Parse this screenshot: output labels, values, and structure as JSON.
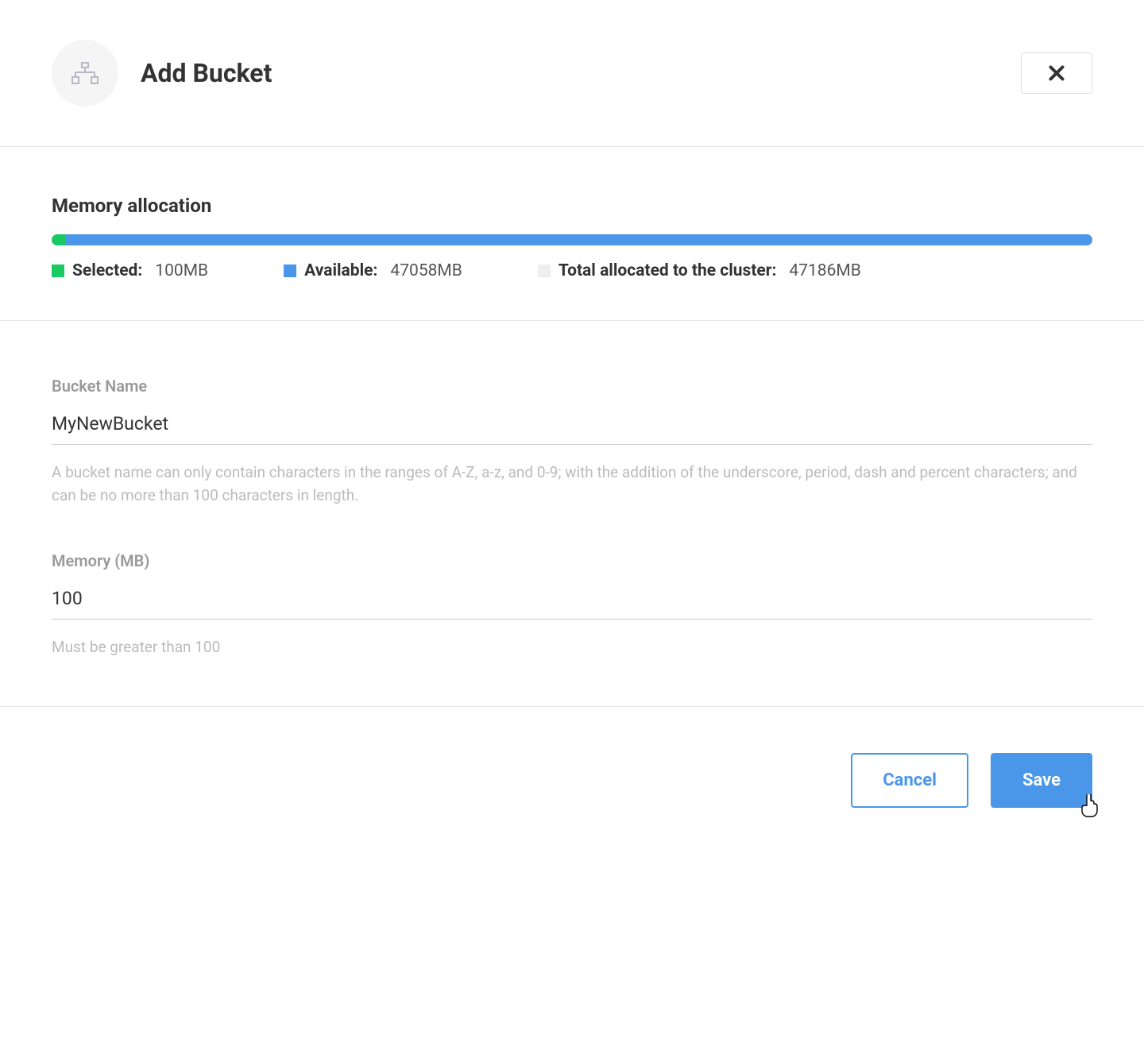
{
  "header": {
    "title": "Add Bucket"
  },
  "memory": {
    "title": "Memory allocation",
    "selected_label": "Selected:",
    "selected_value": "100MB",
    "available_label": "Available:",
    "available_value": "47058MB",
    "total_label": "Total allocated to the cluster:",
    "total_value": "47186MB",
    "selected_pct": 1.4,
    "available_pct": 98.6,
    "total_pct": 0
  },
  "form": {
    "name_label": "Bucket Name",
    "name_value": "MyNewBucket",
    "name_hint": "A bucket name can only contain characters in the ranges of A-Z, a-z, and 0-9; with the addition of the underscore, period, dash and percent characters; and can be no more than 100 characters in length.",
    "memory_label": "Memory (MB)",
    "memory_value": "100",
    "memory_hint": "Must be greater than 100"
  },
  "footer": {
    "cancel_label": "Cancel",
    "save_label": "Save"
  }
}
